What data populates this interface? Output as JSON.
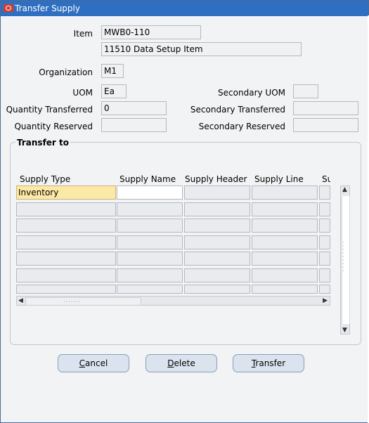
{
  "window": {
    "title": "Transfer Supply"
  },
  "item": {
    "label": "Item",
    "value": "MWB0-110",
    "description": "11510 Data Setup Item"
  },
  "organization": {
    "label": "Organization",
    "value": "M1"
  },
  "uom": {
    "label": "UOM",
    "value": "Ea"
  },
  "secondary_uom": {
    "label": "Secondary UOM",
    "value": ""
  },
  "quantity_transferred": {
    "label": "Quantity Transferred",
    "value": "0"
  },
  "secondary_transferred": {
    "label": "Secondary Transferred",
    "value": ""
  },
  "quantity_reserved": {
    "label": "Quantity Reserved",
    "value": ""
  },
  "secondary_reserved": {
    "label": "Secondary Reserved",
    "value": ""
  },
  "transfer_to": {
    "label": "Transfer to",
    "columns": [
      "Supply Type",
      "Supply Name",
      "Supply Header",
      "Supply Line",
      "Su"
    ],
    "rows": [
      [
        "Inventory",
        "",
        "",
        "",
        ""
      ],
      [
        "",
        "",
        "",
        "",
        ""
      ],
      [
        "",
        "",
        "",
        "",
        ""
      ],
      [
        "",
        "",
        "",
        "",
        ""
      ],
      [
        "",
        "",
        "",
        "",
        ""
      ],
      [
        "",
        "",
        "",
        "",
        ""
      ],
      [
        "",
        "",
        "",
        "",
        ""
      ]
    ]
  },
  "buttons": {
    "cancel": "Cancel",
    "delete": "Delete",
    "transfer": "Transfer"
  },
  "colors": {
    "title_bar": "#2f6fc1",
    "selected_cell": "#fde9a6",
    "button": "#dbe3ee"
  }
}
